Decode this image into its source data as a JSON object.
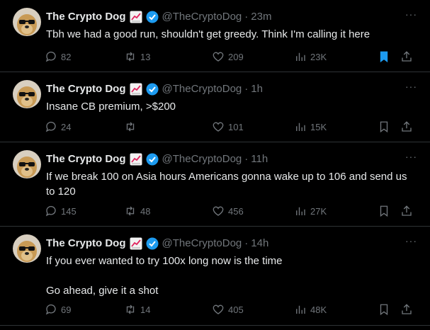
{
  "colors": {
    "background": "#000000",
    "text": "#e7e9ea",
    "muted": "#71767b",
    "divider": "#2f3336",
    "verified": "#1d9bf0",
    "bookmark_active": "#1d9bf0"
  },
  "tweets": [
    {
      "name": "The Crypto Dog",
      "handle": "@TheCryptoDog",
      "separator": "·",
      "time": "23m",
      "text": "Tbh we had a good run, shouldn't get greedy. Think I'm calling it here",
      "replies": "82",
      "retweets": "13",
      "likes": "209",
      "views": "23K",
      "bookmarked": true
    },
    {
      "name": "The Crypto Dog",
      "handle": "@TheCryptoDog",
      "separator": "·",
      "time": "1h",
      "text": "Insane CB premium, >$200",
      "replies": "24",
      "retweets": "",
      "likes": "101",
      "views": "15K",
      "bookmarked": false
    },
    {
      "name": "The Crypto Dog",
      "handle": "@TheCryptoDog",
      "separator": "·",
      "time": "11h",
      "text": "If we break 100 on Asia hours Americans gonna wake up to 106 and send us to 120",
      "replies": "145",
      "retweets": "48",
      "likes": "456",
      "views": "27K",
      "bookmarked": false
    },
    {
      "name": "The Crypto Dog",
      "handle": "@TheCryptoDog",
      "separator": "·",
      "time": "14h",
      "text": "If you ever wanted to try 100x long now is the time\n\nGo ahead, give it a shot",
      "replies": "69",
      "retweets": "14",
      "likes": "405",
      "views": "48K",
      "bookmarked": false
    }
  ],
  "icons": {
    "avatar": "dog-with-sunglasses-avatar",
    "badge_chart": "chart-increasing-icon",
    "badge_verified": "verified-check-icon",
    "more": "more-horizontal-icon",
    "reply": "reply-bubble-icon",
    "retweet": "retweet-icon",
    "like": "heart-icon",
    "views": "views-bar-chart-icon",
    "bookmark": "bookmark-icon",
    "share": "share-icon"
  }
}
